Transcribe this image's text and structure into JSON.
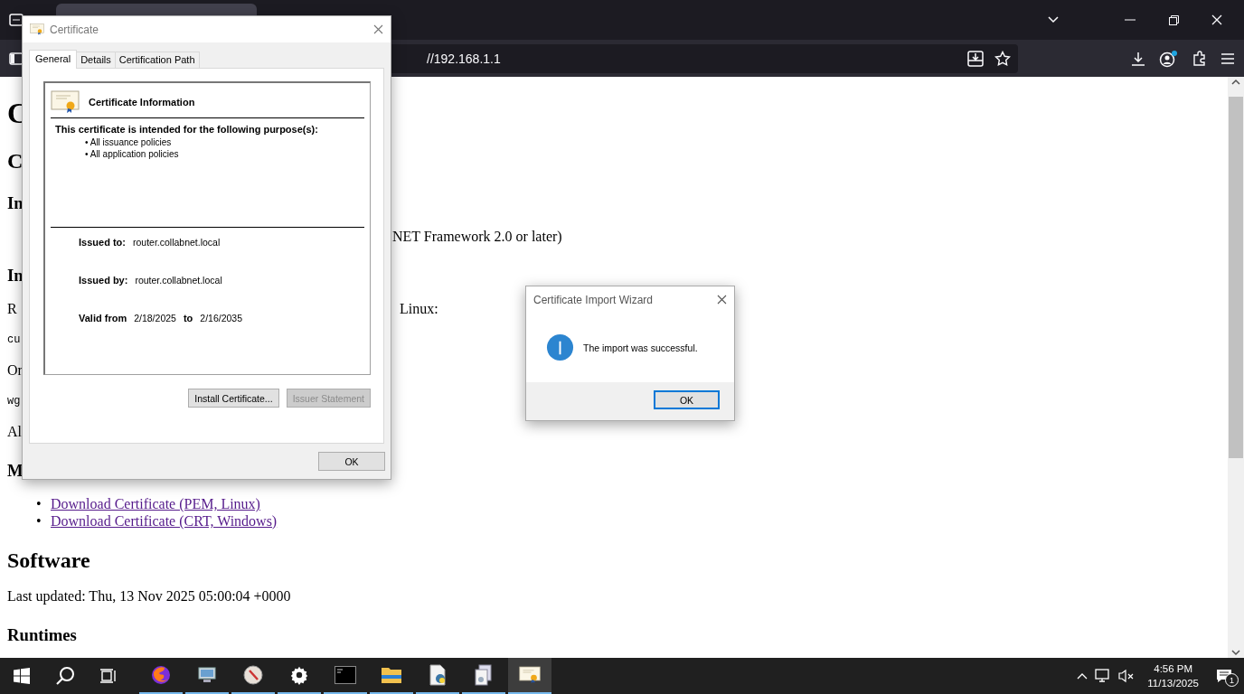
{
  "browser": {
    "url": "//192.168.1.1"
  },
  "page": {
    "blocks": [
      {
        "kind": "h1",
        "text": "C"
      },
      {
        "kind": "h2",
        "text": "C"
      },
      {
        "kind": "h3",
        "text": "In"
      },
      {
        "kind": "p",
        "right": "NET Framework 2.0 or later)"
      },
      {
        "kind": "h3",
        "text": "In"
      },
      {
        "kind": "p",
        "text": "R",
        "right": "Linux:"
      },
      {
        "kind": "code",
        "text": "cu"
      },
      {
        "kind": "p",
        "text": "Or"
      },
      {
        "kind": "code",
        "text": "wg"
      },
      {
        "kind": "p",
        "text": "Al"
      },
      {
        "kind": "h3",
        "text": "M"
      },
      {
        "kind": "links",
        "marker": "•",
        "items": [
          "Download Certificate (PEM, Linux)",
          "Download Certificate (CRT, Windows)"
        ]
      },
      {
        "kind": "h2",
        "text": "Software"
      },
      {
        "kind": "p",
        "text": "Last updated: Thu, 13 Nov 2025 05:00:04 +0000"
      },
      {
        "kind": "h3",
        "text": "Runtimes"
      }
    ]
  },
  "certificate_dialog": {
    "title": "Certificate",
    "tabs": [
      {
        "label": "General",
        "selected": true
      },
      {
        "label": "Details",
        "selected": false
      },
      {
        "label": "Certification Path",
        "selected": false
      }
    ],
    "heading": "Certificate Information",
    "purpose_title": "This certificate is intended for the following purpose(s):",
    "purposes": [
      "• All issuance policies",
      "• All application policies"
    ],
    "fields": [
      {
        "label": "Issued to:",
        "value": "router.collabnet.local"
      },
      {
        "label": "Issued by:",
        "value": "router.collabnet.local"
      }
    ],
    "validity": {
      "label": "Valid from",
      "from": "2/18/2025",
      "to_label": "to",
      "to": "2/16/2035"
    },
    "buttons": [
      {
        "label": "Install Certificate...",
        "disabled": false
      },
      {
        "label": "Issuer Statement",
        "disabled": true
      }
    ],
    "ok": "OK"
  },
  "wizard_dialog": {
    "title": "Certificate Import Wizard",
    "message": "The import was successful.",
    "ok": "OK",
    "ok_default": true
  },
  "taskbar": {
    "apps": [
      {
        "kind": "browser",
        "selected": false
      },
      {
        "kind": "monitor",
        "selected": false
      },
      {
        "kind": "compass",
        "selected": false
      },
      {
        "kind": "gear",
        "selected": false
      },
      {
        "kind": "terminal",
        "selected": false
      },
      {
        "kind": "folder",
        "selected": false
      },
      {
        "kind": "script",
        "selected": false
      },
      {
        "kind": "document",
        "selected": false
      },
      {
        "kind": "certificate",
        "selected": true
      }
    ],
    "time": "4:56 PM",
    "date": "11/13/2025",
    "notifications": "1"
  }
}
